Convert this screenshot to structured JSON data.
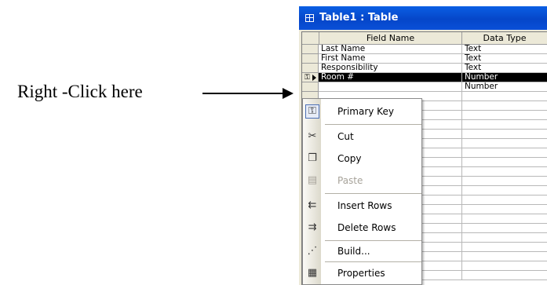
{
  "annotation": {
    "text": "Right -Click here"
  },
  "window": {
    "title": "Table1 : Table",
    "icon": "table-icon"
  },
  "grid": {
    "headers": {
      "field_name": "Field Name",
      "data_type": "Data Type"
    },
    "rows": [
      {
        "field": "Last Name",
        "type": "Text"
      },
      {
        "field": "First Name",
        "type": "Text"
      },
      {
        "field": "Responsibility",
        "type": "Text"
      },
      {
        "field": "Room #",
        "type": "Number",
        "active": true,
        "primary_key": true
      },
      {
        "field": "",
        "type": "Number"
      }
    ]
  },
  "context_menu": {
    "items": [
      {
        "label": "Primary Key",
        "icon": "key-icon",
        "checked": true
      },
      {
        "label": "Cut",
        "icon": "scissors-icon"
      },
      {
        "label": "Copy",
        "icon": "copy-icon"
      },
      {
        "label": "Paste",
        "icon": "clipboard-icon",
        "disabled": true
      },
      {
        "label": "Insert Rows",
        "icon": "insert-rows-icon"
      },
      {
        "label": "Delete Rows",
        "icon": "delete-rows-icon"
      },
      {
        "label": "Build...",
        "icon": "build-wand-icon"
      },
      {
        "label": "Properties",
        "icon": "properties-icon"
      }
    ]
  }
}
